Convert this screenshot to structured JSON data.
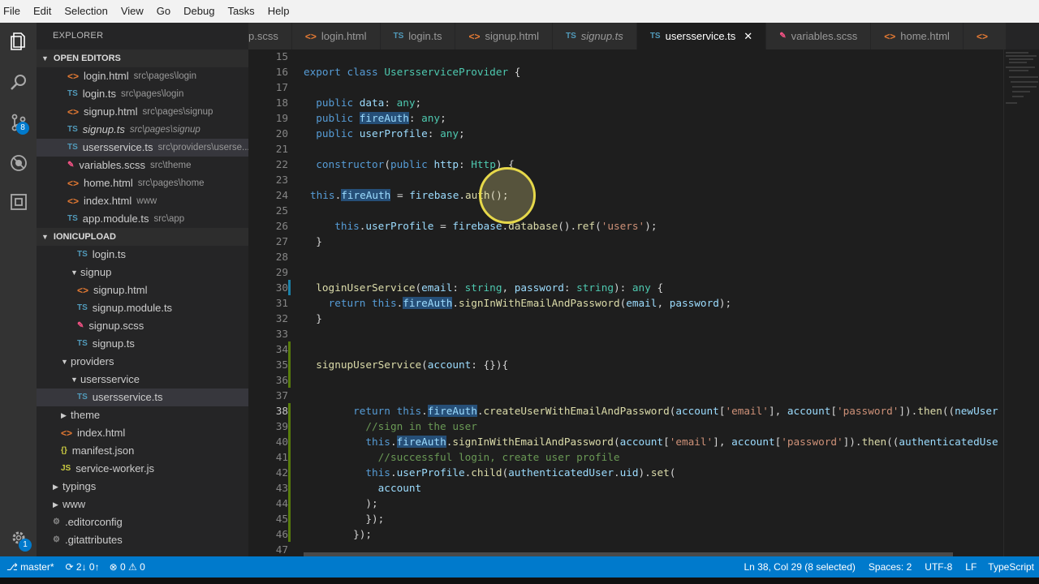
{
  "menu": [
    "File",
    "Edit",
    "Selection",
    "View",
    "Go",
    "Debug",
    "Tasks",
    "Help"
  ],
  "activity": {
    "scm_badge": "8",
    "settings_badge": "1"
  },
  "sidebar": {
    "title": "EXPLORER",
    "open_editors_label": "OPEN EDITORS",
    "open_editors": [
      {
        "name": "login.html",
        "path": "src\\pages\\login",
        "kind": "html"
      },
      {
        "name": "login.ts",
        "path": "src\\pages\\login",
        "kind": "ts"
      },
      {
        "name": "signup.html",
        "path": "src\\pages\\signup",
        "kind": "html"
      },
      {
        "name": "signup.ts",
        "path": "src\\pages\\signup",
        "kind": "ts"
      },
      {
        "name": "usersservice.ts",
        "path": "src\\providers\\userse...",
        "kind": "ts"
      },
      {
        "name": "variables.scss",
        "path": "src\\theme",
        "kind": "scss"
      },
      {
        "name": "home.html",
        "path": "src\\pages\\home",
        "kind": "html"
      },
      {
        "name": "index.html",
        "path": "www",
        "kind": "html"
      },
      {
        "name": "app.module.ts",
        "path": "src\\app",
        "kind": "ts"
      }
    ],
    "project_label": "IONICUPLOAD",
    "tree": [
      {
        "name": "login.ts",
        "kind": "ts",
        "indent": 2
      },
      {
        "name": "signup",
        "kind": "folder-open",
        "indent": 1
      },
      {
        "name": "signup.html",
        "kind": "html",
        "indent": 2
      },
      {
        "name": "signup.module.ts",
        "kind": "ts",
        "indent": 2
      },
      {
        "name": "signup.scss",
        "kind": "scss",
        "indent": 2
      },
      {
        "name": "signup.ts",
        "kind": "ts",
        "indent": 2
      },
      {
        "name": "providers",
        "kind": "folder-open",
        "indent": 0
      },
      {
        "name": "usersservice",
        "kind": "folder-open",
        "indent": 1
      },
      {
        "name": "usersservice.ts",
        "kind": "ts",
        "indent": 2
      },
      {
        "name": "theme",
        "kind": "folder",
        "indent": 0
      },
      {
        "name": "index.html",
        "kind": "html",
        "indent": 0
      },
      {
        "name": "manifest.json",
        "kind": "json",
        "indent": 0
      },
      {
        "name": "service-worker.js",
        "kind": "js",
        "indent": 0
      },
      {
        "name": "typings",
        "kind": "folder",
        "indent": -1
      },
      {
        "name": "www",
        "kind": "folder",
        "indent": -1
      },
      {
        "name": ".editorconfig",
        "kind": "cfg",
        "indent": -1
      },
      {
        "name": ".gitattributes",
        "kind": "cfg",
        "indent": -1
      }
    ]
  },
  "tabs": [
    {
      "label": "p.scss",
      "kind": "scss"
    },
    {
      "label": "login.html",
      "kind": "html"
    },
    {
      "label": "login.ts",
      "kind": "ts"
    },
    {
      "label": "signup.html",
      "kind": "html"
    },
    {
      "label": "signup.ts",
      "kind": "ts"
    },
    {
      "label": "usersservice.ts",
      "kind": "ts",
      "active": true
    },
    {
      "label": "variables.scss",
      "kind": "scss"
    },
    {
      "label": "home.html",
      "kind": "html"
    },
    {
      "label": "",
      "kind": "html"
    }
  ],
  "editor": {
    "lines": [
      {
        "n": "15",
        "html": ""
      },
      {
        "n": "16",
        "html": "<span class=\"kw\">export</span> <span class=\"kw\">class</span> <span class=\"cls\">UsersserviceProvider</span> {"
      },
      {
        "n": "17",
        "html": ""
      },
      {
        "n": "18",
        "html": "  <span class=\"kw\">public</span> <span class=\"var\">data</span>: <span class=\"cls\">any</span>;"
      },
      {
        "n": "19",
        "html": "  <span class=\"kw\">public</span> <span class=\"var hl\">fireAuth</span>: <span class=\"cls\">any</span>;"
      },
      {
        "n": "20",
        "html": "  <span class=\"kw\">public</span> <span class=\"var\">userProfile</span>: <span class=\"cls\">any</span>;"
      },
      {
        "n": "21",
        "html": ""
      },
      {
        "n": "22",
        "html": "  <span class=\"kw\">constructor</span>(<span class=\"kw\">public</span> <span class=\"var\">http</span>: <span class=\"cls\">Http</span>) {"
      },
      {
        "n": "23",
        "html": ""
      },
      {
        "n": "24",
        "html": "<span class=\"kw\">this</span>.<span class=\"var hl\">fireAuth</span> = <span class=\"var\">firebase</span>.<span class=\"fn\">auth</span>();"
      },
      {
        "n": "25",
        "html": ""
      },
      {
        "n": "26",
        "html": "     <span class=\"kw\">this</span>.<span class=\"var\">userProfile</span> = <span class=\"var\">firebase</span>.<span class=\"fn\">database</span>().<span class=\"fn\">ref</span>(<span class=\"str\">'users'</span>);"
      },
      {
        "n": "27",
        "html": "  }"
      },
      {
        "n": "28",
        "html": ""
      },
      {
        "n": "29",
        "html": ""
      },
      {
        "n": "30",
        "html": "  <span class=\"fn\">loginUserService</span>(<span class=\"var\">email</span>: <span class=\"cls\">string</span>, <span class=\"var\">password</span>: <span class=\"cls\">string</span>): <span class=\"cls\">any</span> {"
      },
      {
        "n": "31",
        "html": "    <span class=\"kw\">return</span> <span class=\"kw\">this</span>.<span class=\"var hl\">fireAuth</span>.<span class=\"fn\">signInWithEmailAndPassword</span>(<span class=\"var\">email</span>, <span class=\"var\">password</span>);"
      },
      {
        "n": "32",
        "html": "  }"
      },
      {
        "n": "33",
        "html": ""
      },
      {
        "n": "34",
        "html": ""
      },
      {
        "n": "35",
        "html": "  <span class=\"fn\">signupUserService</span>(<span class=\"var\">account</span>: {}){"
      },
      {
        "n": "36",
        "html": ""
      },
      {
        "n": "37",
        "html": ""
      },
      {
        "n": "38",
        "html": "        <span class=\"kw\">return</span> <span class=\"kw\">this</span>.<span class=\"var hl\">fireAuth</span>.<span class=\"fn\">createUserWithEmailAndPassword</span>(<span class=\"var\">account</span>[<span class=\"str\">'email'</span>], <span class=\"var\">account</span>[<span class=\"str\">'password'</span>]).<span class=\"fn\">then</span>((<span class=\"var\">newUser</span>"
      },
      {
        "n": "39",
        "html": "          <span class=\"cm\">//sign in the user</span>"
      },
      {
        "n": "40",
        "html": "          <span class=\"kw\">this</span>.<span class=\"var hl\">fireAuth</span>.<span class=\"fn\">signInWithEmailAndPassword</span>(<span class=\"var\">account</span>[<span class=\"str\">'email'</span>], <span class=\"var\">account</span>[<span class=\"str\">'password'</span>]).<span class=\"fn\">then</span>((<span class=\"var\">authenticatedUse</span>"
      },
      {
        "n": "41",
        "html": "            <span class=\"cm\">//successful login, create user profile</span>"
      },
      {
        "n": "42",
        "html": "          <span class=\"kw\">this</span>.<span class=\"var\">userProfile</span>.<span class=\"fn\">child</span>(<span class=\"var\">authenticatedUser</span>.<span class=\"var\">uid</span>).<span class=\"fn\">set</span>("
      },
      {
        "n": "43",
        "html": "            <span class=\"var\">account</span>"
      },
      {
        "n": "44",
        "html": "          );"
      },
      {
        "n": "45",
        "html": "          });"
      },
      {
        "n": "46",
        "html": "        });"
      },
      {
        "n": "47",
        "html": ""
      }
    ],
    "modified_lines": [
      "30",
      "34",
      "35",
      "36",
      "38",
      "39",
      "40",
      "41",
      "42",
      "43",
      "44",
      "45",
      "46"
    ]
  },
  "status": {
    "branch": "master*",
    "sync": "2↓ 0↑",
    "errors": "0",
    "warnings": "0",
    "position": "Ln 38, Col 29 (8 selected)",
    "spaces": "Spaces: 2",
    "encoding": "UTF-8",
    "eol": "LF",
    "language": "TypeScript"
  },
  "colors": {
    "accent": "#007acc",
    "highlight": "#264f78"
  }
}
